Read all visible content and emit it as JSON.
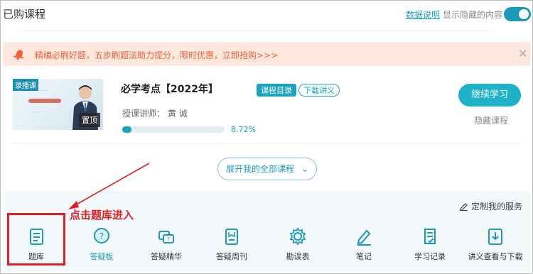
{
  "header": {
    "title": "已购课程",
    "data_link": "数据说明",
    "show_hidden_label": "显示隐藏的内容",
    "show_hidden_on": true
  },
  "banner": {
    "text": "精编必刷好题，五步刷题法助力提分，限时优惠，立即抢购>>>"
  },
  "course": {
    "thumb_badge": "录播课",
    "thumb_pin": "置顶",
    "name": "必学考点【2022年】",
    "tag_catalog": "课程目录",
    "tag_download": "下载讲义",
    "teacher": "授课讲师：  黄   诚",
    "progress_percent": 8.72,
    "progress_text": "8.72%",
    "continue_label": "继续学习",
    "hide_label": "隐藏课程"
  },
  "expand_label": "展开我的全部课程",
  "custom_service": "定制我的服务",
  "annotation": "点击题库进入",
  "tools": [
    {
      "label": "题库",
      "icon": "question-bank-icon"
    },
    {
      "label": "答疑板",
      "icon": "qa-board-icon"
    },
    {
      "label": "答疑精华",
      "icon": "qa-essence-icon"
    },
    {
      "label": "答疑周刊",
      "icon": "qa-weekly-icon"
    },
    {
      "label": "勘误表",
      "icon": "errata-icon"
    },
    {
      "label": "笔记",
      "icon": "notes-icon"
    },
    {
      "label": "学习记录",
      "icon": "study-record-icon"
    },
    {
      "label": "讲义查看与下载",
      "icon": "handout-download-icon"
    }
  ],
  "colors": {
    "accent": "#1a9ab8",
    "banner_bg": "#fde6dc",
    "banner_text": "#f0623c",
    "annotation": "#e02020"
  }
}
